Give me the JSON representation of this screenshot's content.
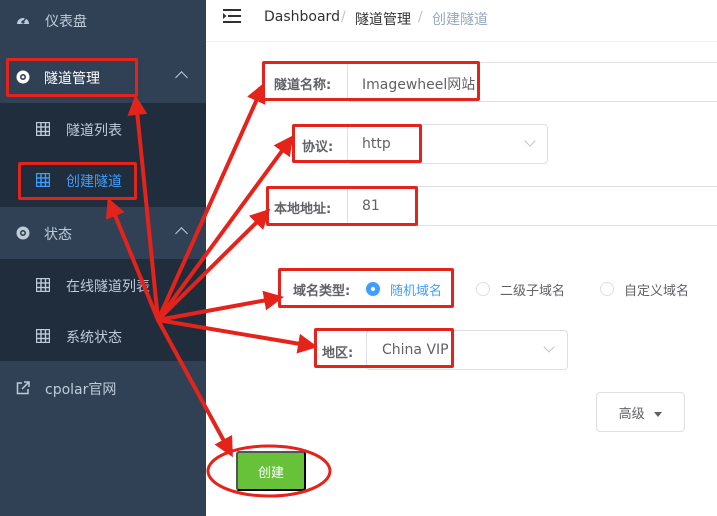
{
  "sidebar": {
    "items": [
      {
        "label": "仪表盘",
        "icon": "dashboard-gauge-icon"
      },
      {
        "label": "隧道管理",
        "icon": "tunnel-compass-icon"
      },
      {
        "label": "隧道列表",
        "icon": "grid-table-icon"
      },
      {
        "label": "创建隧道",
        "icon": "grid-table-icon"
      },
      {
        "label": "状态",
        "icon": "status-compass-icon"
      },
      {
        "label": "在线隧道列表",
        "icon": "grid-table-icon"
      },
      {
        "label": "系统状态",
        "icon": "grid-table-icon"
      },
      {
        "label": "cpolar官网",
        "icon": "external-link-icon"
      }
    ]
  },
  "header": {
    "breadcrumb": [
      "Dashboard",
      "隧道管理",
      "创建隧道"
    ],
    "separator": "/"
  },
  "form": {
    "name_label": "隧道名称:",
    "name_value": "Imagewheel网站",
    "protocol_label": "协议:",
    "protocol_value": "http",
    "local_label": "本地地址:",
    "local_value": "81",
    "domain_type_label": "域名类型:",
    "domain_type_options": [
      "随机域名",
      "二级子域名",
      "自定义域名"
    ],
    "domain_type_selected": "随机域名",
    "region_label": "地区:",
    "region_value": "China VIP",
    "advanced_label": "高级",
    "create_label": "创建"
  },
  "colors": {
    "sidebar_bg": "#304156",
    "submenu_bg": "#1f2d3d",
    "active_text": "#409eff",
    "create_button": "#67c23a",
    "annotation_red": "#e4231b"
  }
}
